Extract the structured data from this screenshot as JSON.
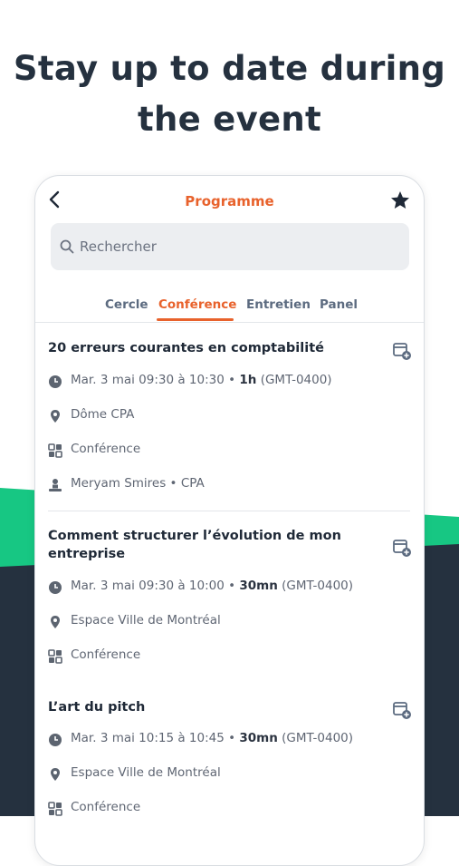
{
  "headline": {
    "line1": "Stay up to date during",
    "line2": "the event"
  },
  "colors": {
    "accent": "#e8622c",
    "green": "#17c783",
    "dark": "#25313f"
  },
  "header": {
    "title": "Programme",
    "back_icon": "chevron-left-icon",
    "favorite_icon": "star-icon"
  },
  "search": {
    "placeholder": "Rechercher"
  },
  "tabs": [
    {
      "label": "Cercle",
      "active": false
    },
    {
      "label": "Conférence",
      "active": true
    },
    {
      "label": "Entretien",
      "active": false
    },
    {
      "label": "Panel",
      "active": false
    }
  ],
  "events": [
    {
      "title": "20 erreurs courantes en comptabilité",
      "date": "Mar. 3 mai 09:30 à 10:30",
      "duration": "1h",
      "tz": "(GMT-0400)",
      "location": "Dôme CPA",
      "type": "Conférence",
      "speaker": "Meryam Smires • CPA"
    },
    {
      "title": "Comment structurer l’évolution de mon entreprise",
      "date": "Mar. 3 mai 09:30 à 10:00",
      "duration": "30mn",
      "tz": "(GMT-0400)",
      "location": "Espace Ville de Montréal",
      "type": "Conférence"
    },
    {
      "title": "L’art du pitch",
      "date": "Mar. 3 mai 10:15 à 10:45",
      "duration": "30mn",
      "tz": "(GMT-0400)",
      "location": "Espace Ville de Montréal",
      "type": "Conférence"
    }
  ]
}
